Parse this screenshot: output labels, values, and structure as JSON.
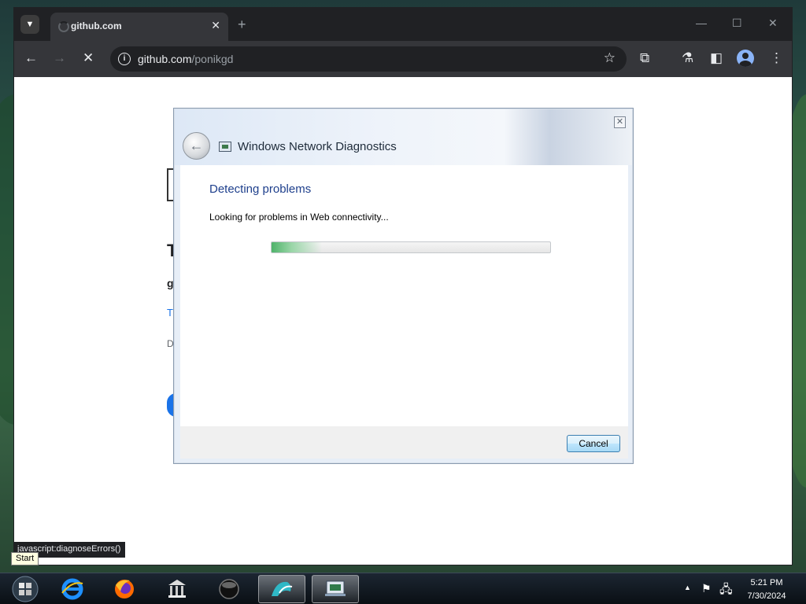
{
  "browser": {
    "tab": {
      "title": "github.com"
    },
    "address": {
      "host": "github.com",
      "path": "/ponikgd"
    },
    "status_link": "javascript:diagnoseErrors()"
  },
  "dialog": {
    "title": "Windows Network Diagnostics",
    "heading": "Detecting problems",
    "status_text": "Looking for problems in Web connectivity...",
    "progress_fraction": 0.18,
    "cancel_label": "Cancel"
  },
  "taskbar": {
    "start_tooltip": "Start",
    "time": "5:21 PM",
    "date": "7/30/2024",
    "apps": [
      "internet-explorer",
      "firefox",
      "library",
      "media-player",
      "photo-viewer",
      "network-diagnostics"
    ]
  },
  "page_fragments": {
    "line1": "T",
    "line2": "g",
    "line3": "T",
    "line4": "D"
  },
  "colors": {
    "dialog_heading": "#1e3f8c",
    "browser_chrome": "#202124",
    "toolbar": "#35363a"
  }
}
